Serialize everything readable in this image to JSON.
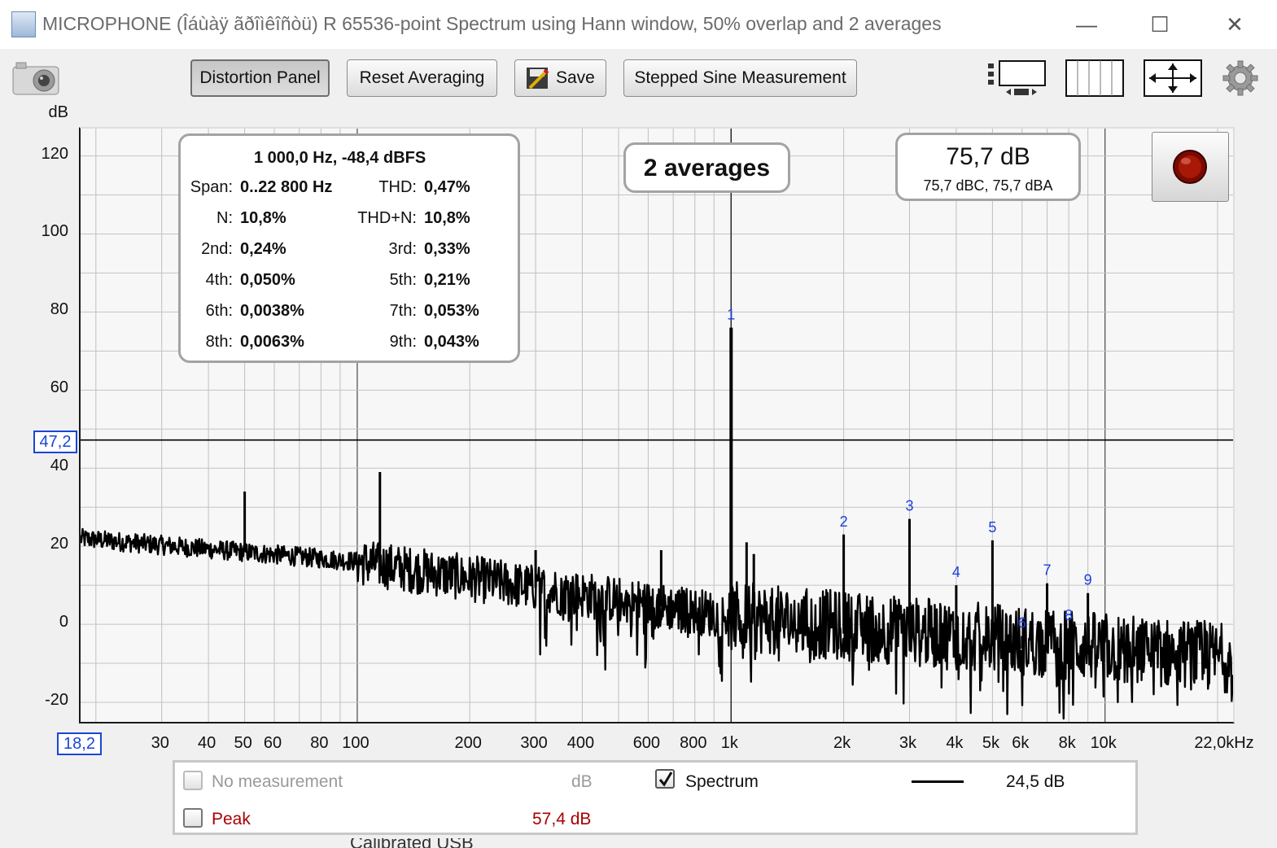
{
  "window": {
    "title": "MICROPHONE (Îáùàÿ ãðîìêîñòü) R 65536-point Spectrum using Hann window, 50% overlap and 2 averages",
    "minimize_glyph": "—",
    "maximize_glyph": "☐",
    "close_glyph": "✕"
  },
  "toolbar": {
    "distortion_panel": "Distortion Panel",
    "reset_averaging": "Reset Averaging",
    "save": "Save",
    "stepped_sine": "Stepped Sine Measurement",
    "icons": [
      "camera-icon",
      "save-icon",
      "vertical-zoom-icon",
      "horizontal-zoom-icon",
      "zoom-fit-icon",
      "settings-gear-icon"
    ]
  },
  "distortion": {
    "header": "1 000,0 Hz, -48,4 dBFS",
    "rows": [
      {
        "l_label": "Span:",
        "l_value": "0..22 800 Hz",
        "r_label": "THD:",
        "r_value": "0,47%"
      },
      {
        "l_label": "N:",
        "l_value": "10,8%",
        "r_label": "THD+N:",
        "r_value": "10,8%"
      },
      {
        "l_label": "2nd:",
        "l_value": "0,24%",
        "r_label": "3rd:",
        "r_value": "0,33%"
      },
      {
        "l_label": "4th:",
        "l_value": "0,050%",
        "r_label": "5th:",
        "r_value": "0,21%"
      },
      {
        "l_label": "6th:",
        "l_value": "0,0038%",
        "r_label": "7th:",
        "r_value": "0,053%"
      },
      {
        "l_label": "8th:",
        "l_value": "0,0063%",
        "r_label": "9th:",
        "r_value": "0,043%"
      }
    ]
  },
  "averages_label": "2 averages",
  "level": {
    "main": "75,7 dB",
    "sub": "75,7 dBC, 75,7 dBA"
  },
  "chart_data": {
    "type": "line",
    "title": "",
    "ylabel": "dB",
    "xlabel": "",
    "x_scale": "log",
    "xlim_hz": [
      18.2,
      22000
    ],
    "ylim": [
      -25,
      127
    ],
    "y_ticks": [
      "120",
      "100",
      "80",
      "60",
      "40",
      "20",
      "0",
      "-20"
    ],
    "x_ticks": [
      {
        "hz": 30,
        "label": "30"
      },
      {
        "hz": 40,
        "label": "40"
      },
      {
        "hz": 50,
        "label": "50"
      },
      {
        "hz": 60,
        "label": "60"
      },
      {
        "hz": 80,
        "label": "80"
      },
      {
        "hz": 100,
        "label": "100"
      },
      {
        "hz": 200,
        "label": "200"
      },
      {
        "hz": 300,
        "label": "300"
      },
      {
        "hz": 400,
        "label": "400"
      },
      {
        "hz": 600,
        "label": "600"
      },
      {
        "hz": 800,
        "label": "800"
      },
      {
        "hz": 1000,
        "label": "1k"
      },
      {
        "hz": 2000,
        "label": "2k"
      },
      {
        "hz": 3000,
        "label": "3k"
      },
      {
        "hz": 4000,
        "label": "4k"
      },
      {
        "hz": 5000,
        "label": "5k"
      },
      {
        "hz": 6000,
        "label": "6k"
      },
      {
        "hz": 8000,
        "label": "8k"
      },
      {
        "hz": 10000,
        "label": "10k"
      },
      {
        "hz": 22000,
        "label": "22,0kHz"
      }
    ],
    "x_start_label": "18,2",
    "cursor_db": 47.2,
    "cursor_label": "47,2",
    "harmonics": [
      {
        "n": "1",
        "hz": 1000,
        "db": 76
      },
      {
        "n": "2",
        "hz": 2000,
        "db": 23
      },
      {
        "n": "3",
        "hz": 3000,
        "db": 27
      },
      {
        "n": "4",
        "hz": 4000,
        "db": 10
      },
      {
        "n": "5",
        "hz": 5000,
        "db": 21.5
      },
      {
        "n": "6",
        "hz": 6000,
        "db": -3
      },
      {
        "n": "7",
        "hz": 7000,
        "db": 10.5
      },
      {
        "n": "8",
        "hz": 8000,
        "db": -1
      },
      {
        "n": "9",
        "hz": 9000,
        "db": 8
      }
    ],
    "other_peaks": [
      {
        "hz": 50,
        "db": 34
      },
      {
        "hz": 115,
        "db": 39
      },
      {
        "hz": 300,
        "db": 19
      },
      {
        "hz": 650,
        "db": 19
      },
      {
        "hz": 1100,
        "db": 21
      },
      {
        "hz": 1150,
        "db": 18
      }
    ],
    "series": [
      {
        "name": "Spectrum",
        "color": "#000000"
      }
    ]
  },
  "legend": {
    "no_measurement": "No measurement",
    "no_measurement_unit": "dB",
    "spectrum": "Spectrum",
    "spectrum_value": "24,5 dB",
    "peak": "Peak",
    "peak_value": "57,4 dB",
    "peak_color": "#a80000"
  },
  "partial_bottom_text": "Calibrated USB"
}
